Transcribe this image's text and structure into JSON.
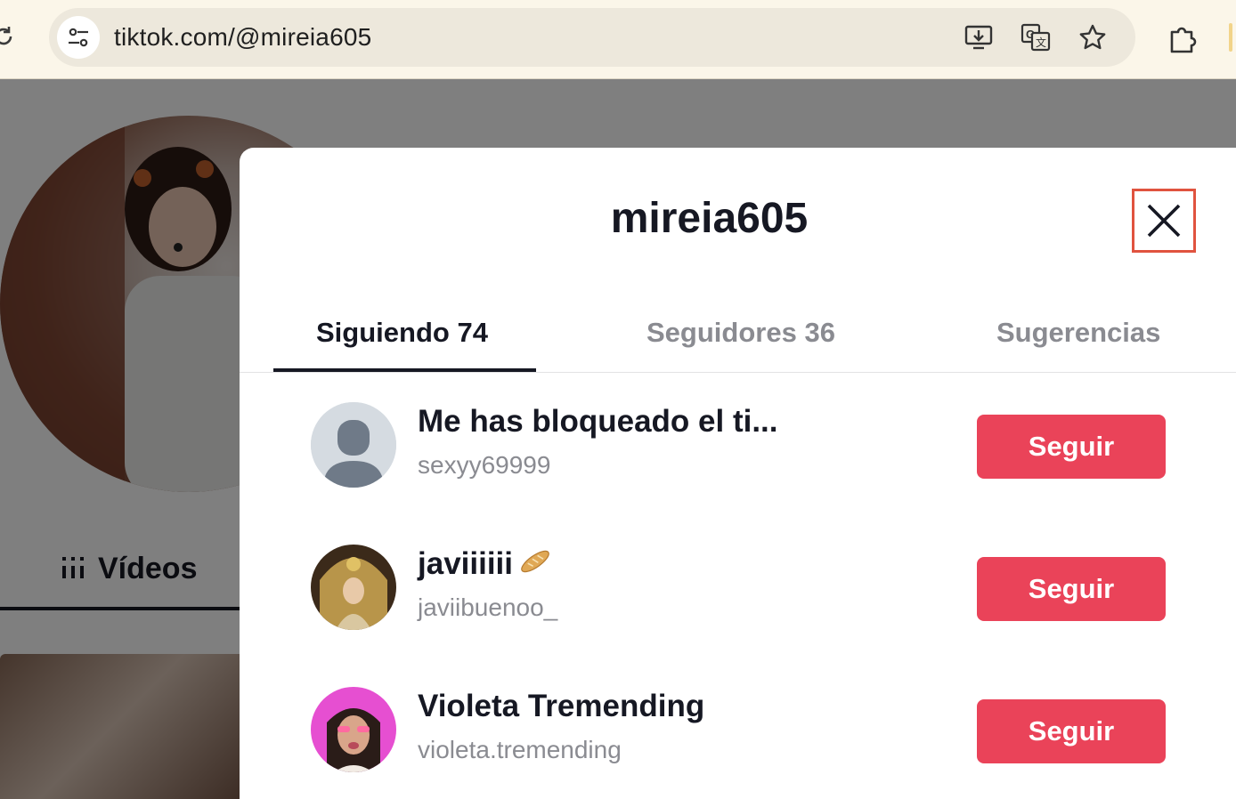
{
  "browser": {
    "url": "tiktok.com/@mireia605",
    "icons": [
      "reload-icon",
      "site-info-icon",
      "install-app-icon",
      "translate-icon",
      "bookmark-star-icon",
      "extensions-icon"
    ]
  },
  "profile": {
    "videos_tab_label": "Vídeos"
  },
  "modal": {
    "title": "mireia605",
    "tabs": [
      {
        "label": "Siguiendo",
        "count": "74",
        "active": true
      },
      {
        "label": "Seguidores",
        "count": "36",
        "active": false
      },
      {
        "label": "Sugerencias",
        "count": "",
        "active": false
      }
    ],
    "users": [
      {
        "name": "Me has bloqueado el ti...",
        "handle": "sexyy69999",
        "button": "Seguir"
      },
      {
        "name": "javiiiiii",
        "handle": "javiibuenoo_",
        "button": "Seguir",
        "emoji": "bread-icon"
      },
      {
        "name": "Violeta Tremending",
        "handle": "violeta.tremending",
        "button": "Seguir"
      }
    ]
  },
  "colors": {
    "follow_button": "#ea4359",
    "close_highlight": "#e0533f",
    "text_primary": "#161823",
    "text_secondary": "#8a8b91"
  }
}
